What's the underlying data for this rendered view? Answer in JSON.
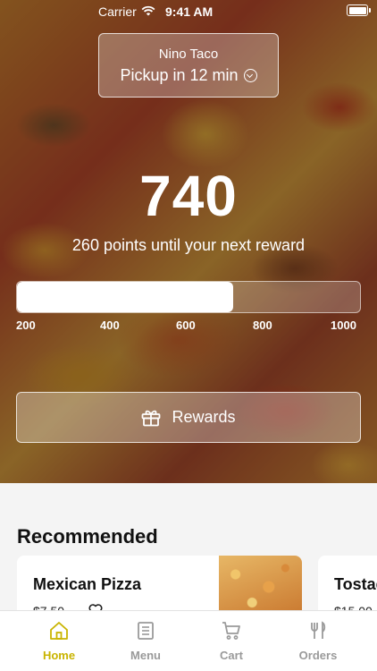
{
  "status_bar": {
    "carrier": "Carrier",
    "time": "9:41 AM"
  },
  "location": {
    "name": "Nino Taco",
    "pickup": "Pickup in 12 min"
  },
  "points": {
    "value": "740",
    "caption": "260 points until your next reward",
    "progress_fraction": 0.63,
    "ticks": [
      "200",
      "400",
      "600",
      "800",
      "1000"
    ]
  },
  "rewards_button": {
    "label": "Rewards"
  },
  "recommended": {
    "title": "Recommended",
    "items": [
      {
        "name": "Mexican Pizza",
        "price": "$7.50"
      },
      {
        "name": "Tostada",
        "price": "$15.00"
      }
    ]
  },
  "tab_bar": {
    "items": [
      {
        "label": "Home",
        "icon": "home-icon",
        "active": true
      },
      {
        "label": "Menu",
        "icon": "menu-icon",
        "active": false
      },
      {
        "label": "Cart",
        "icon": "cart-icon",
        "active": false
      },
      {
        "label": "Orders",
        "icon": "fork-knife-icon",
        "active": false
      }
    ]
  },
  "colors": {
    "accent": "#c9b400",
    "inactive": "#9a9a9a"
  }
}
